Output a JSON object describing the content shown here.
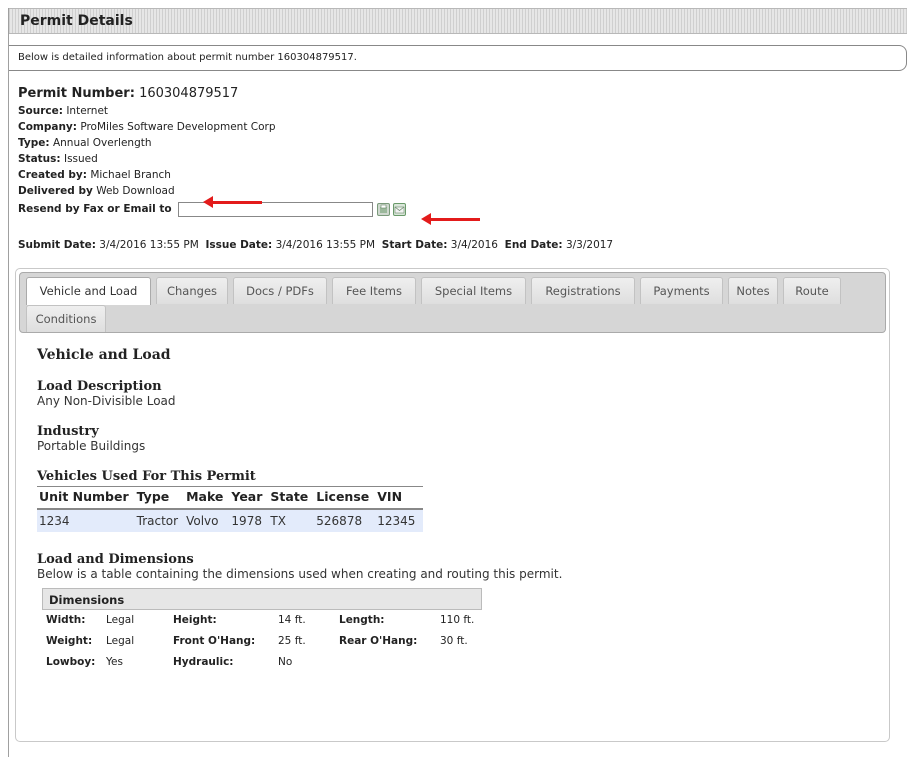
{
  "panel": {
    "title": "Permit Details"
  },
  "intro": "Below is detailed information about permit number 160304879517.",
  "details": {
    "permit_number_label": "Permit Number:",
    "permit_number": "160304879517",
    "source_label": "Source:",
    "source": "Internet",
    "company_label": "Company:",
    "company": "ProMiles Software Development Corp",
    "type_label": "Type:",
    "type": "Annual Overlength",
    "status_label": "Status:",
    "status": "Issued",
    "created_label": "Created by:",
    "created": "Michael Branch",
    "delivered_label": "Delivered by",
    "delivered": "Web Download",
    "resend_label": "Resend by Fax or Email to",
    "resend_value": ""
  },
  "dates": {
    "submit_label": "Submit Date:",
    "submit": "3/4/2016 13:55 PM",
    "issue_label": "Issue Date:",
    "issue": "3/4/2016 13:55 PM",
    "start_label": "Start Date:",
    "start": "3/4/2016",
    "end_label": "End Date:",
    "end": "3/3/2017"
  },
  "tabs": [
    {
      "label": "Vehicle and Load"
    },
    {
      "label": "Changes"
    },
    {
      "label": "Docs / PDFs"
    },
    {
      "label": "Fee Items"
    },
    {
      "label": "Special Items"
    },
    {
      "label": "Registrations"
    },
    {
      "label": "Payments"
    },
    {
      "label": "Notes"
    },
    {
      "label": "Route"
    },
    {
      "label": "Conditions"
    }
  ],
  "content": {
    "title": "Vehicle and Load",
    "load_desc_label": "Load Description",
    "load_desc": "Any Non-Divisible Load",
    "industry_label": "Industry",
    "industry": "Portable Buildings",
    "vehicles_title": "Vehicles Used For This Permit",
    "vehicle_columns": [
      "Unit Number",
      "Type",
      "Make",
      "Year",
      "State",
      "License",
      "VIN"
    ],
    "vehicle_rows": [
      [
        "1234",
        "Tractor",
        "Volvo",
        "1978",
        "TX",
        "526878",
        "12345"
      ]
    ],
    "dims_title": "Load and Dimensions",
    "dims_desc": "Below is a table containing the dimensions used when creating and routing this permit.",
    "dims_header": "Dimensions",
    "dims": {
      "width_label": "Width:",
      "width": "Legal",
      "height_label": "Height:",
      "height": "14 ft.",
      "length_label": "Length:",
      "length": "110 ft.",
      "weight_label": "Weight:",
      "weight": "Legal",
      "front_label": "Front O'Hang:",
      "front": "25 ft.",
      "rear_label": "Rear O'Hang:",
      "rear": "30 ft.",
      "lowboy_label": "Lowboy:",
      "lowboy": "Yes",
      "hydraulic_label": "Hydraulic:",
      "hydraulic": "No"
    }
  },
  "colors": {
    "arrow": "#e31b1b",
    "row_highlight": "#e3ebfb",
    "tabbar": "#d6d6d6"
  },
  "icons": [
    "fax-icon",
    "email-icon"
  ]
}
